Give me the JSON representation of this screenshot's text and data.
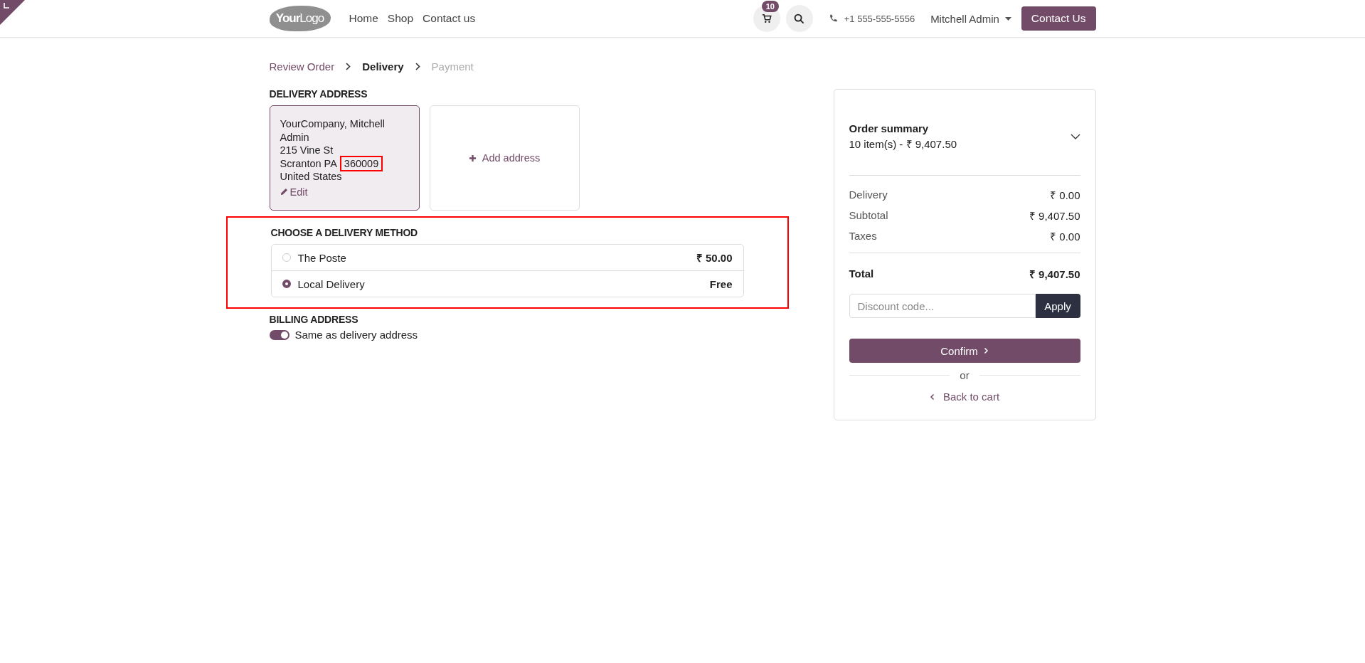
{
  "header": {
    "logo": "**Your**Logo",
    "nav": [
      {
        "label": "Home"
      },
      {
        "label": "Shop"
      },
      {
        "label": "Contact us"
      }
    ],
    "cart_count": "10",
    "phone": "+1 555-555-5556",
    "user": "Mitchell Admin",
    "cta": "Contact Us"
  },
  "breadcrumb": [
    {
      "label": "Review Order",
      "completed": true,
      "selected": false
    },
    {
      "label": "Delivery",
      "completed": false,
      "selected": true
    },
    {
      "label": "Payment",
      "completed": false,
      "selected": false
    }
  ],
  "delivery_address": {
    "heading": "DELIVERY ADDRESS",
    "card": {
      "selected": true,
      "name": "YourCompany, Mitchell Admin",
      "street": "215 Vine St",
      "city": "Scranton PA",
      "zip": "360009",
      "zip_highlighted": true,
      "country": "United States",
      "edit": "Edit"
    },
    "add": "Add address"
  },
  "delivery_method": {
    "heading": "CHOOSE A DELIVERY METHOD",
    "highlighted": true,
    "options": [
      {
        "label": "The Poste",
        "price": "₹ 50.00",
        "selected": false
      },
      {
        "label": "Local Delivery",
        "price": "Free",
        "selected": true
      }
    ]
  },
  "billing": {
    "heading": "BILLING ADDRESS",
    "toggle": {
      "label": "Same as delivery address",
      "on": true
    }
  },
  "summary": {
    "title": "Order summary",
    "subtitle": "10 item(s) -  ₹ 9,407.50",
    "expanded": false,
    "lines": [
      {
        "label": "Delivery",
        "value": "₹ 0.00"
      },
      {
        "label": "Subtotal",
        "value": "₹ 9,407.50"
      },
      {
        "label": "Taxes",
        "value": "₹ 0.00"
      }
    ],
    "total_label": "Total",
    "total": "₹ 9,407.50",
    "discount_placeholder": "Discount code...",
    "apply": "Apply",
    "confirm": "Confirm",
    "or": "or",
    "back": "Back to cart"
  }
}
